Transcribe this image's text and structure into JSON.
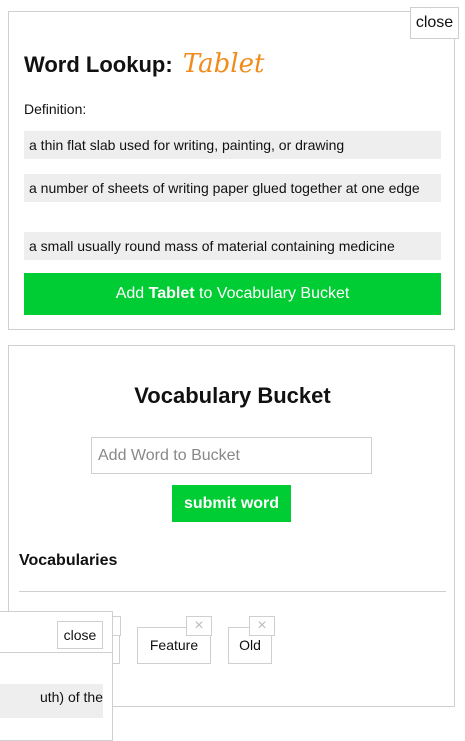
{
  "lookup": {
    "close_label": "close",
    "title_prefix": "Word Lookup:",
    "word": "Tablet",
    "definition_label": "Definition:",
    "definitions": [
      "a thin flat slab used for writing, painting, or drawing",
      "a number of sheets of writing paper glued together at one edge",
      "a small usually round mass of material containing medicine"
    ],
    "add_prefix": "Add",
    "add_word": "Tablet",
    "add_suffix": "to Vocabulary Bucket"
  },
  "bucket": {
    "title": "Vocabulary Bucket",
    "input_placeholder": "Add Word to Bucket",
    "input_value": "",
    "submit_label": "submit word",
    "vocab_heading": "Vocabularies",
    "chips": [
      {
        "label": "",
        "remove_icon": "×"
      },
      {
        "label": "Feature",
        "remove_icon": "×"
      },
      {
        "label": "Old",
        "remove_icon": "×"
      }
    ]
  },
  "popup": {
    "close_label": "close",
    "definition_fragment": "uth) of the"
  },
  "colors": {
    "accent_green": "#00cc33",
    "word_orange": "#f08b1c",
    "definition_bg": "#eeeeee",
    "border": "#cfcfcf"
  }
}
